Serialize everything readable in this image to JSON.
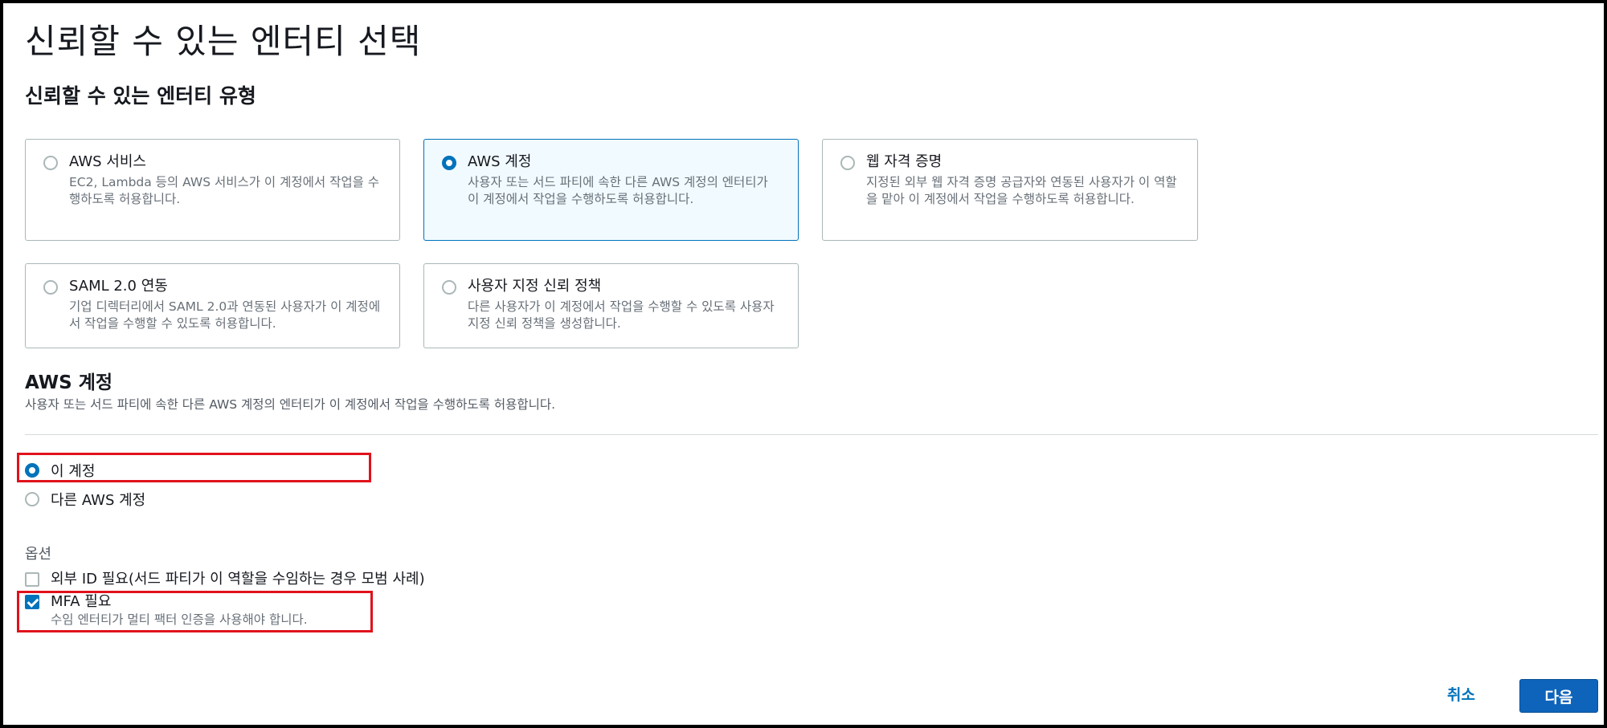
{
  "page": {
    "title": "신뢰할 수 있는 엔터티 선택",
    "entity_type_heading": "신뢰할 수 있는 엔터티 유형"
  },
  "tiles": [
    {
      "title": "AWS 서비스",
      "desc": "EC2, Lambda 등의 AWS 서비스가 이 계정에서 작업을 수행하도록 허용합니다.",
      "selected": false
    },
    {
      "title": "AWS 계정",
      "desc": "사용자 또는 서드 파티에 속한 다른 AWS 계정의 엔터티가 이 계정에서 작업을 수행하도록 허용합니다.",
      "selected": true
    },
    {
      "title": "웹 자격 증명",
      "desc": "지정된 외부 웹 자격 증명 공급자와 연동된 사용자가 이 역할을 맡아 이 계정에서 작업을 수행하도록 허용합니다.",
      "selected": false
    },
    {
      "title": "SAML 2.0 연동",
      "desc": "기업 디렉터리에서 SAML 2.0과 연동된 사용자가 이 계정에서 작업을 수행할 수 있도록 허용합니다.",
      "selected": false
    },
    {
      "title": "사용자 지정 신뢰 정책",
      "desc": "다른 사용자가 이 계정에서 작업을 수행할 수 있도록 사용자 지정 신뢰 정책을 생성합니다.",
      "selected": false
    }
  ],
  "account": {
    "heading": "AWS 계정",
    "desc": "사용자 또는 서드 파티에 속한 다른 AWS 계정의 엔터티가 이 계정에서 작업을 수행하도록 허용합니다.",
    "this_account": "이 계정",
    "other_account": "다른 AWS 계정"
  },
  "options": {
    "label": "옵션",
    "external_id": "외부 ID 필요(서드 파티가 이 역할을 수임하는 경우 모범 사례)",
    "mfa_label": "MFA 필요",
    "mfa_desc": "수임 엔터티가 멀티 팩터 인증을 사용해야 합니다."
  },
  "footer": {
    "cancel": "취소",
    "next": "다음"
  },
  "colors": {
    "accent": "#0073bb",
    "primary_button": "#0e64ba",
    "highlight": "#e0121c"
  }
}
